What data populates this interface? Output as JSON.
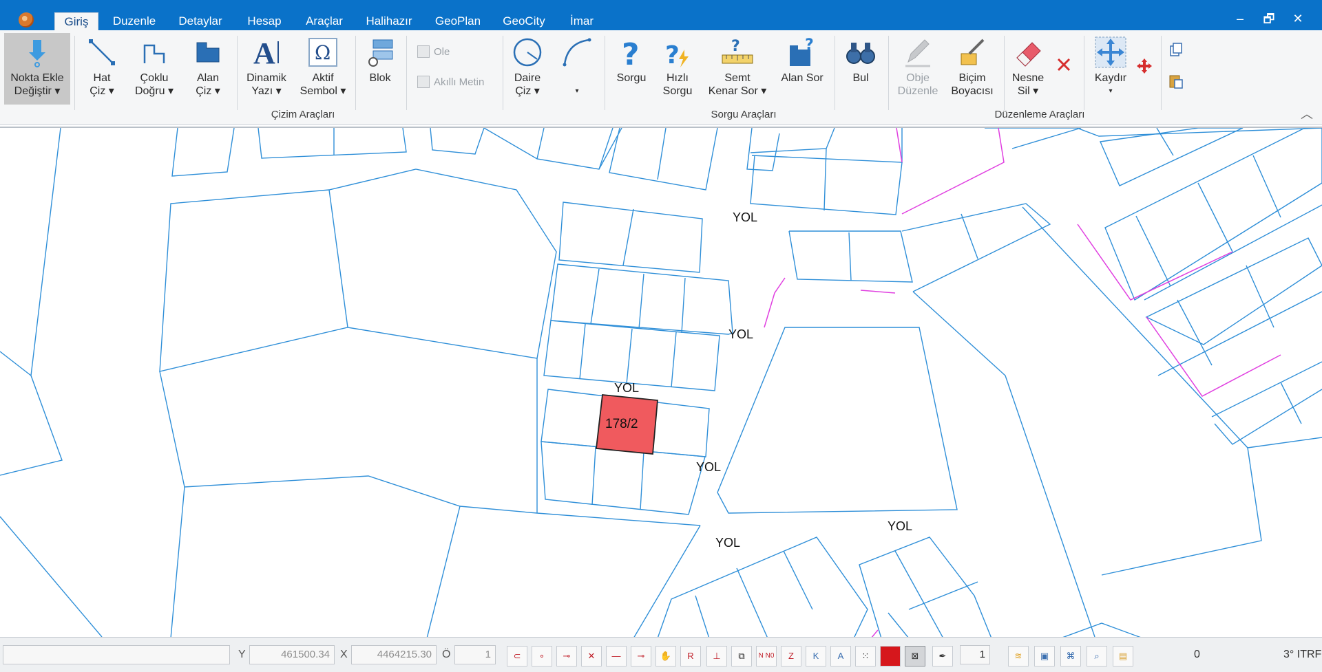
{
  "tabs": [
    {
      "label": "Giriş",
      "active": true
    },
    {
      "label": "Duzenle"
    },
    {
      "label": "Detaylar"
    },
    {
      "label": "Hesap"
    },
    {
      "label": "Araçlar"
    },
    {
      "label": "Halihazır"
    },
    {
      "label": "GeoPlan"
    },
    {
      "label": "GeoCity"
    },
    {
      "label": "İmar"
    }
  ],
  "window": {
    "minimize": "–",
    "restore": "🗗",
    "close": "✕"
  },
  "ribbon": {
    "nokta_ekle": {
      "l1": "Nokta Ekle",
      "l2": "Değiştir ▾"
    },
    "hat_ciz": {
      "l1": "Hat",
      "l2": "Çiz ▾"
    },
    "coklu_dogru": {
      "l1": "Çoklu",
      "l2": "Doğru ▾"
    },
    "alan_ciz": {
      "l1": "Alan",
      "l2": "Çiz ▾"
    },
    "dinamik_yazi": {
      "l1": "Dinamik",
      "l2": "Yazı ▾"
    },
    "aktif_sembol": {
      "l1": "Aktif",
      "l2": "Sembol ▾"
    },
    "blok": {
      "l1": "Blok"
    },
    "ole": "Ole",
    "akilli_metin": "Akıllı Metin",
    "daire_ciz": {
      "l1": "Daire",
      "l2": "Çiz ▾"
    },
    "arc_caret": "▾",
    "sorgu": {
      "l1": "Sorgu"
    },
    "hizli_sorgu": {
      "l1": "Hızlı",
      "l2": "Sorgu"
    },
    "semt_kenar": {
      "l1": "Semt",
      "l2": "Kenar Sor ▾"
    },
    "alan_sor": {
      "l1": "Alan Sor"
    },
    "bul": {
      "l1": "Bul"
    },
    "obje_duzenle": {
      "l1": "Obje",
      "l2": "Düzenle"
    },
    "bicim_boyacisi": {
      "l1": "Biçim",
      "l2": "Boyacısı"
    },
    "nesne_sil": {
      "l1": "Nesne",
      "l2": "Sil ▾"
    },
    "kaydir": {
      "l1": "Kaydır",
      "l2": "▾"
    },
    "groups": {
      "cizim": "Çizim Araçları",
      "sorgu": "Sorgu Araçları",
      "duzenleme": "Düzenleme Araçları"
    },
    "collapse": "︿"
  },
  "map": {
    "road_labels": [
      "YOL",
      "YOL",
      "YOL",
      "YOL",
      "YOL",
      "YOL"
    ],
    "selected_parcel": "178/2",
    "colors": {
      "parcel_line": "#2f8fd8",
      "magenta_line": "#e03fe0",
      "selected_fill": "#f05a5e"
    }
  },
  "status": {
    "message": "",
    "y_label": "Y",
    "y_value": "461500.34",
    "x_label": "X",
    "x_value": "4464215.30",
    "o_label": "Ö",
    "o_value": "1",
    "tools": [
      "magnet-icon",
      "point-snap-icon",
      "end-snap-icon",
      "intersection-snap-icon",
      "line-snap-icon",
      "mid-snap-icon",
      "hand-icon",
      "R",
      "perpendicular-icon",
      "overlap-icon",
      "N N0",
      "Z",
      "K",
      "A",
      "grid-dots-icon",
      "color-swatch",
      "frame-icon",
      "pen-icon"
    ],
    "spin_value": "1",
    "count": "0",
    "projection": "3° ITRF"
  }
}
